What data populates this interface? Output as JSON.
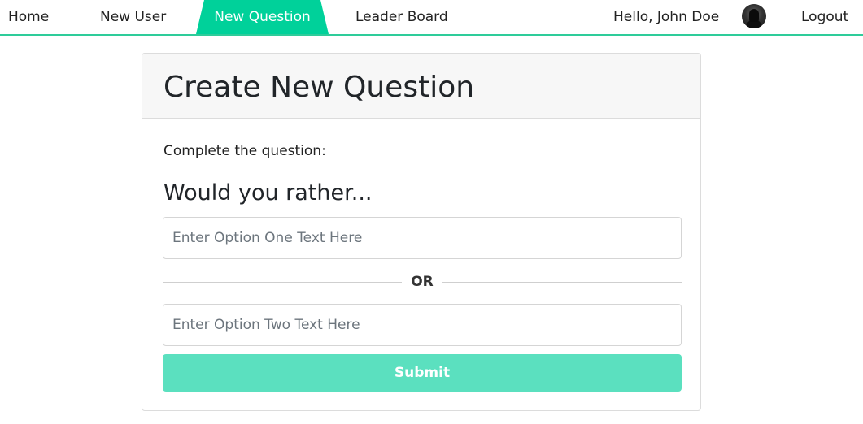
{
  "navbar": {
    "home_label": "Home",
    "new_user_label": "New User",
    "new_question_label": "New Question",
    "leader_board_label": "Leader Board",
    "greeting": "Hello, John Doe",
    "logout_label": "Logout",
    "active_tab_color": "#00d19a",
    "underline_color": "#2ecc9a"
  },
  "card": {
    "title": "Create New Question",
    "prompt": "Complete the question:",
    "subtitle": "Would you rather...",
    "option_one_placeholder": "Enter Option One Text Here",
    "option_one_value": "",
    "separator_label": "OR",
    "option_two_placeholder": "Enter Option Two Text Here",
    "option_two_value": "",
    "submit_label": "Submit",
    "submit_color": "#5be0bf"
  },
  "icons": {
    "avatar": "user-avatar-icon"
  }
}
